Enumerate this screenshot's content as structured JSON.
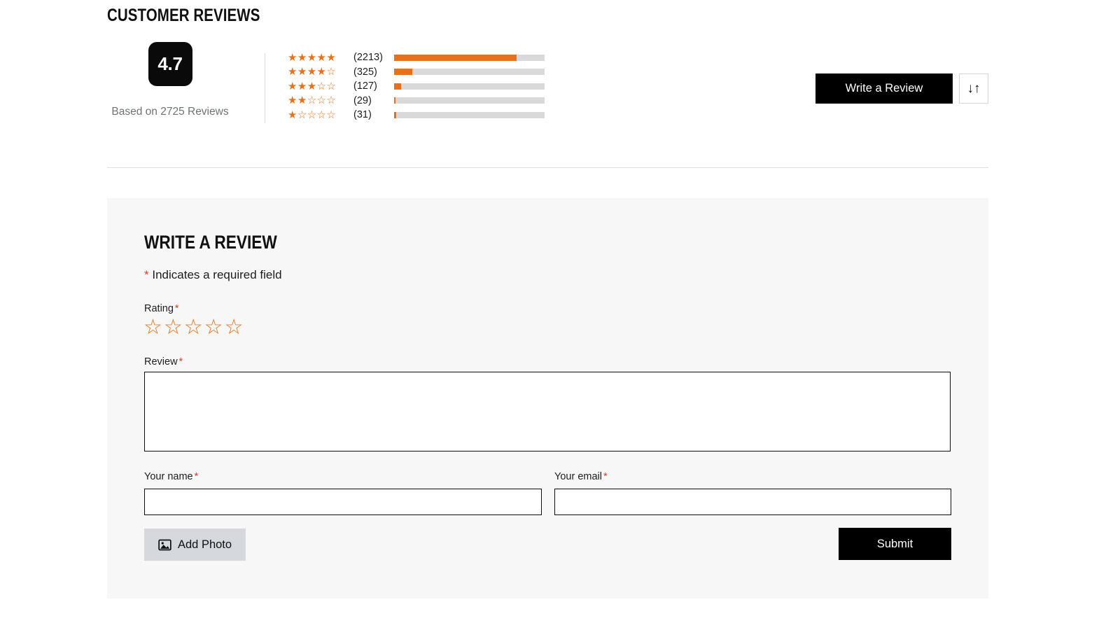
{
  "section": {
    "title": "CUSTOMER REVIEWS"
  },
  "summary": {
    "score": "4.7",
    "based_on": "Based on 2725 Reviews",
    "total_reviews": 2725
  },
  "histogram": {
    "rows": [
      {
        "stars": 5,
        "stars_glyphs": "★★★★★",
        "count_label": "(2213)",
        "count": 2213,
        "percent": 81.2
      },
      {
        "stars": 4,
        "stars_glyphs": "★★★★☆",
        "count_label": "(325)",
        "count": 325,
        "percent": 11.9
      },
      {
        "stars": 3,
        "stars_glyphs": "★★★☆☆",
        "count_label": "(127)",
        "count": 127,
        "percent": 4.7
      },
      {
        "stars": 2,
        "stars_glyphs": "★★☆☆☆",
        "count_label": "(29)",
        "count": 29,
        "percent": 1.1
      },
      {
        "stars": 1,
        "stars_glyphs": "★☆☆☆☆",
        "count_label": "(31)",
        "count": 31,
        "percent": 1.2
      }
    ]
  },
  "actions": {
    "write_review_label": "Write a Review",
    "sort_icon": "sort-arrows-icon",
    "sort_glyphs": "↓↑"
  },
  "form": {
    "title": "WRITE A REVIEW",
    "required_marker": "*",
    "required_note": "Indicates a required field",
    "rating": {
      "label": "Rating",
      "stars_glyphs": "☆☆☆☆☆",
      "value": 0
    },
    "review": {
      "label": "Review",
      "value": "",
      "placeholder": ""
    },
    "name": {
      "label": "Your name",
      "value": "",
      "placeholder": ""
    },
    "email": {
      "label": "Your email",
      "value": "",
      "placeholder": ""
    },
    "add_photo_label": "Add Photo",
    "add_photo_icon": "image-icon",
    "submit_label": "Submit"
  },
  "colors": {
    "accent_orange": "#e8701a",
    "track_gray": "#d9d9d9",
    "required_red": "#e8352b",
    "panel_gray": "#f7f7f7",
    "button_black": "#000000",
    "add_photo_gray": "#d5d8dd"
  }
}
